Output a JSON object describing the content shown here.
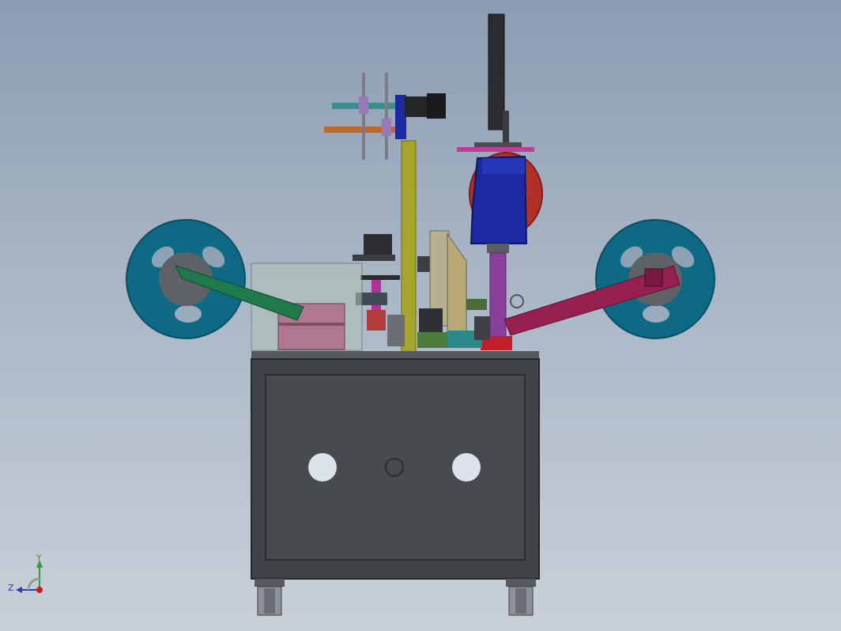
{
  "viewport": {
    "background_top": "#8c9db2",
    "background_bottom": "#c9d0d9"
  },
  "triad": {
    "y_label": "Y",
    "z_label": "Z",
    "y_color": "#2fa02f",
    "z_color": "#1f3fbf",
    "x_color": "#d01a1a"
  },
  "icons": {
    "reel_left": "tape-reel-icon",
    "reel_right": "tape-reel-icon",
    "monitor": "monitor-icon",
    "orientation_triad": "axis-triad-icon"
  },
  "colors": {
    "cabinet": "#3f4449",
    "cabinet_panel": "#464b50",
    "reel": "#0e6a84",
    "left_arm": "#1e7a4a",
    "right_arm": "#96204f",
    "column": "#a6a42a",
    "blue_head": "#1c2aa2",
    "red_disc": "#b0302a"
  }
}
